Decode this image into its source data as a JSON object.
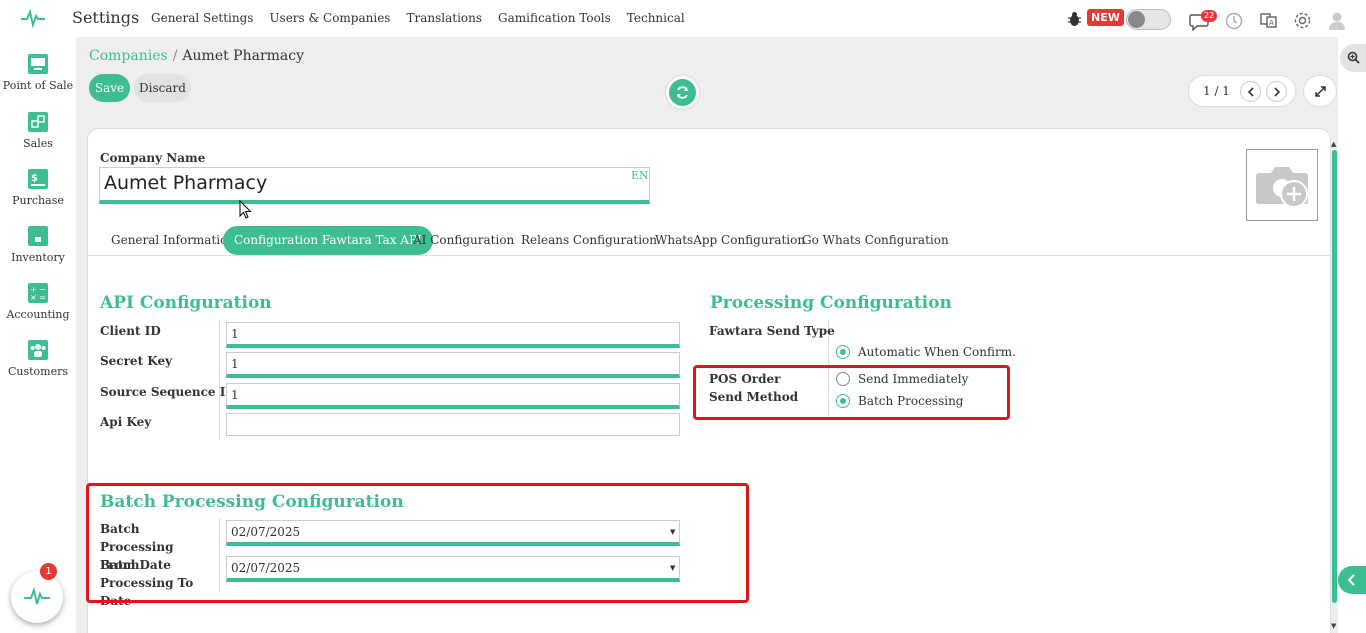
{
  "app": {
    "title": "Settings",
    "menu": [
      "General Settings",
      "Users & Companies",
      "Translations",
      "Gamification Tools",
      "Technical"
    ],
    "new_badge": "NEW",
    "chat_count": "22",
    "accent_color": "#3dbd92",
    "highlight_color": "#e0141e"
  },
  "sidebar": {
    "items": [
      {
        "label": "Point of Sale",
        "icon": "monitor-icon"
      },
      {
        "label": "Sales",
        "icon": "sales-icon"
      },
      {
        "label": "Purchase",
        "icon": "dollar-receipt-icon"
      },
      {
        "label": "Inventory",
        "icon": "box-icon"
      },
      {
        "label": "Accounting",
        "icon": "calculator-icon"
      },
      {
        "label": "Customers",
        "icon": "people-icon"
      }
    ],
    "fab_badge": "1"
  },
  "breadcrumb": {
    "parent": "Companies",
    "separator": "/",
    "current": "Aumet Pharmacy"
  },
  "actions": {
    "save": "Save",
    "discard": "Discard"
  },
  "pager": {
    "value": "1 / 1"
  },
  "form": {
    "company_name_label": "Company Name",
    "company_name_value": "Aumet Pharmacy",
    "language": "EN",
    "tabs": [
      {
        "label": "General Information",
        "active": false
      },
      {
        "label": "Configuration Fawtara Tax API",
        "active": true
      },
      {
        "label": "AI Configuration",
        "active": false
      },
      {
        "label": "Releans Configuration",
        "active": false
      },
      {
        "label": "WhatsApp Configuration",
        "active": false
      },
      {
        "label": "Go Whats Configuration",
        "active": false
      }
    ],
    "api": {
      "title": "API Configuration",
      "client_id_label": "Client ID",
      "client_id_value": "1",
      "secret_key_label": "Secret Key",
      "secret_key_value": "1",
      "source_seq_label": "Source Sequence ID",
      "source_seq_value": "1",
      "api_key_label": "Api Key",
      "api_key_value": ""
    },
    "processing": {
      "title": "Processing Configuration",
      "send_type_label": "Fawtara Send Type",
      "send_type_option": "Automatic When Confirm.",
      "pos_method_label": "POS Order Send Method",
      "pos_options": [
        {
          "label": "Send Immediately",
          "selected": false
        },
        {
          "label": "Batch Processing",
          "selected": true
        }
      ]
    },
    "batch": {
      "title": "Batch Processing Configuration",
      "from_label": "Batch Processing From Date",
      "from_value": "02/07/2025",
      "to_label": "Batch Processing To Date",
      "to_value": "02/07/2025"
    }
  }
}
